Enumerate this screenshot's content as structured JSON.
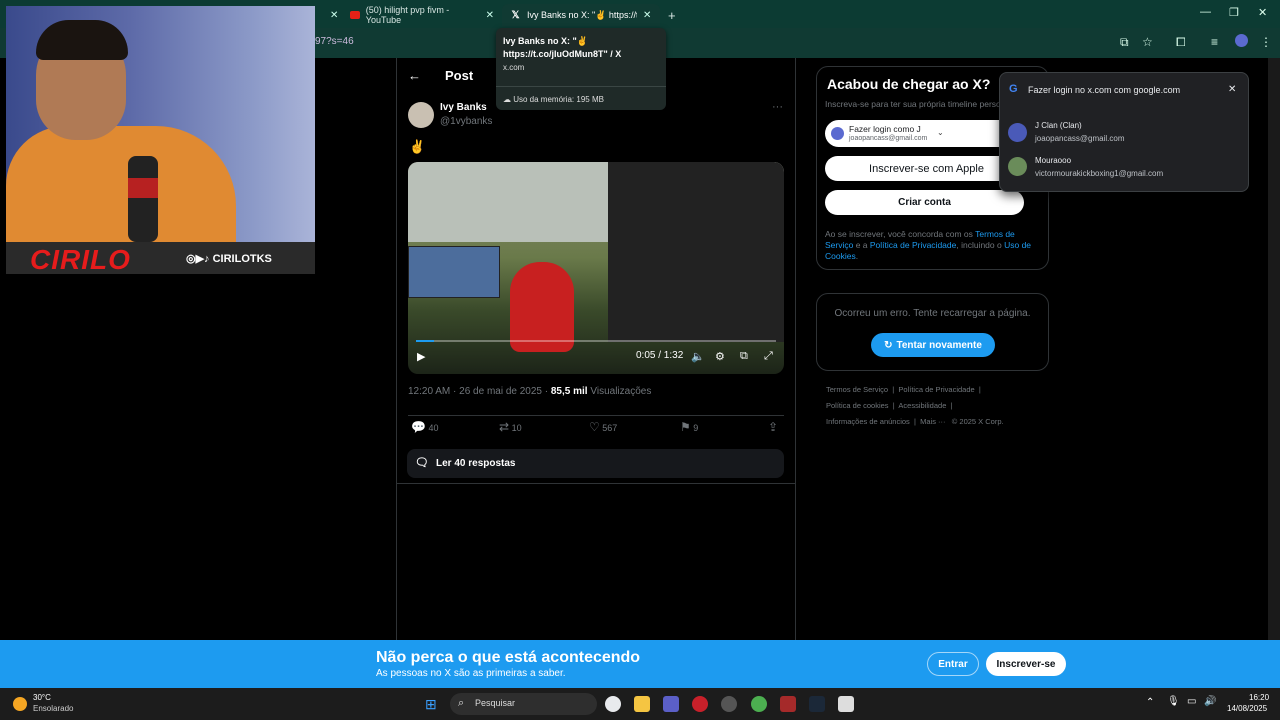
{
  "browser": {
    "tabs": [
      {
        "label": "(50) hilight pvp fivm - YouTube",
        "favicon": "youtube-icon"
      },
      {
        "label": "Ivy Banks no X: \"✌ https://t.co/j",
        "favicon": "x-icon",
        "active": true
      }
    ],
    "tab_close": "✕",
    "new_tab": "+",
    "url_fragment": "97?s=46",
    "window_controls": [
      "—",
      "❐",
      "✕"
    ]
  },
  "tooltip": {
    "title": "Ivy Banks no X: \"✌ https://t.co/jIuOdMun8T\" / X",
    "domain": "x.com",
    "memory": "Uso da memória: 195 MB"
  },
  "webcam": {
    "banner_name": "CIRILO",
    "handle": "◎▶♪ CIRILOTKS"
  },
  "post": {
    "header": "Post",
    "back": "←",
    "author_name": "Ivy Banks",
    "author_handle": "@1vybanks",
    "more": "···",
    "text": "✌",
    "video_time": "0:05 / 1:32",
    "timestamp": "12:20 AM · 26 de mai de 2025 · ",
    "views_count": "85,5 mil",
    "views_label": " Visualizações",
    "replies": "40",
    "reposts": "10",
    "likes": "567",
    "bookmarks": "9",
    "read_replies": "Ler 40 respostas"
  },
  "signup_card": {
    "title": "Acabou de chegar ao X?",
    "subtitle": "Inscreva-se para ter sua própria timeline perso",
    "google_login_label": "Fazer login como J",
    "google_login_email": "joaopancass@gmail.com",
    "apple_label": "Inscrever-se com Apple",
    "create_account": "Criar conta",
    "legal_prefix": "Ao se inscrever, você concorda com os ",
    "terms": "Termos de Serviço",
    "legal_and": " e a ",
    "privacy": "Política de Privacidade",
    "legal_including": ", incluindo o ",
    "cookies": "Uso de Cookies",
    "legal_end": "."
  },
  "error_card": {
    "message": "Ocorreu um erro. Tente recarregar a página.",
    "retry": "Tentar novamente"
  },
  "footer_links": {
    "row1": [
      "Termos de Serviço",
      "Política de Privacidade"
    ],
    "row2": [
      "Política de cookies",
      "Acessibilidade"
    ],
    "row3": [
      "Informações de anúncios",
      "Mais ···",
      "© 2025 X Corp."
    ]
  },
  "google_popup": {
    "title": "Fazer login no x.com com google.com",
    "accounts": [
      {
        "name": "J Clan (Clan)",
        "email": "joaopancass@gmail.com"
      },
      {
        "name": "Mouraooo",
        "email": "victormourakickboxing1@gmail.com"
      }
    ]
  },
  "bottom_banner": {
    "title": "Não perca o que está acontecendo",
    "subtitle": "As pessoas no X são as primeiras a saber.",
    "login": "Entrar",
    "signup": "Inscrever-se"
  },
  "taskbar": {
    "weather_temp": "30°C",
    "weather_desc": "Ensolarado",
    "search": "Pesquisar",
    "time": "16:20",
    "date": "14/08/2025"
  },
  "colors": {
    "accent": "#1d9bf0",
    "chrome_tabstrip": "#0c3b33",
    "background": "#000000"
  }
}
